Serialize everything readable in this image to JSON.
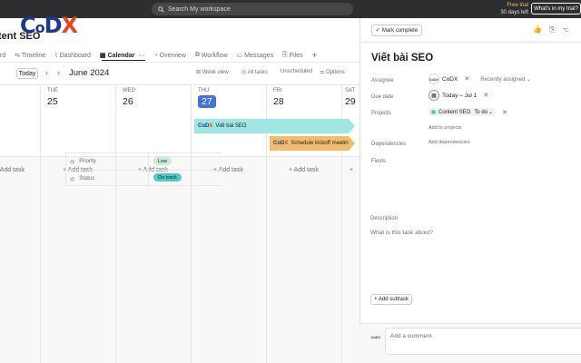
{
  "brand": {
    "logo_letters": [
      "C",
      "o",
      "D",
      "X"
    ]
  },
  "topbar": {
    "search_placeholder": "Search My workspace",
    "trial_line1": "Free trial",
    "trial_line2": "30 days left",
    "trial_button": "What's in my trial?"
  },
  "project": {
    "title": "tent SEO"
  },
  "tabs": [
    {
      "label": "ard",
      "icon": ""
    },
    {
      "label": "Timeline",
      "icon": "timeline-icon"
    },
    {
      "label": "Dashboard",
      "icon": "dashboard-icon"
    },
    {
      "label": "Calendar",
      "icon": "calendar-icon",
      "active": true
    },
    {
      "label": "Overview",
      "icon": "overview-icon"
    },
    {
      "label": "Workflow",
      "icon": "workflow-icon"
    },
    {
      "label": "Messages",
      "icon": "messages-icon"
    },
    {
      "label": "Files",
      "icon": "files-icon"
    }
  ],
  "toolbar": {
    "today": "Today",
    "month": "June 2024",
    "week_view": "Week view",
    "all_tasks": "All tasks",
    "unscheduled": "Unscheduled",
    "options": "Options"
  },
  "calendar": {
    "days": [
      {
        "dow": "TUE",
        "num": "25"
      },
      {
        "dow": "WED",
        "num": "26"
      },
      {
        "dow": "THU",
        "num": "27",
        "today": true
      },
      {
        "dow": "FRI",
        "num": "28"
      },
      {
        "dow": "SAT",
        "num": "29"
      }
    ],
    "add_task": "+ Add task",
    "events": [
      {
        "title": "Viết bài SEO",
        "color": "#9ee7e3"
      },
      {
        "title": "Schedule kickoff meeting",
        "color": "#f1bd6c"
      }
    ]
  },
  "panel": {
    "mark_complete": "Mark complete",
    "task_title": "Viết bài SEO",
    "assignee_label": "Assignee",
    "assignee_name": "CoDX",
    "recently_assigned": "Recently assigned",
    "due_label": "Due date",
    "due_value": "Today – Jul 1",
    "projects_label": "Projects",
    "project_name": "Content SEO",
    "project_section": "To do",
    "add_to_projects": "Add to projects",
    "dependencies_label": "Dependencies",
    "add_dependencies": "Add dependencies",
    "fields_label": "Fields",
    "fields": [
      {
        "name": "Priority",
        "value": "Low",
        "color": "#c7eed2"
      },
      {
        "name": "Status",
        "value": "On track",
        "color": "#4ecbc4"
      }
    ],
    "description_label": "Description",
    "description_placeholder": "What is this task about?",
    "add_subtask": "+ Add subtask",
    "comment_placeholder": "Add a comment"
  },
  "colors": {
    "accent": "#4573d2",
    "brand_blue": "#1b3a8a",
    "brand_orange": "#e8451e"
  }
}
